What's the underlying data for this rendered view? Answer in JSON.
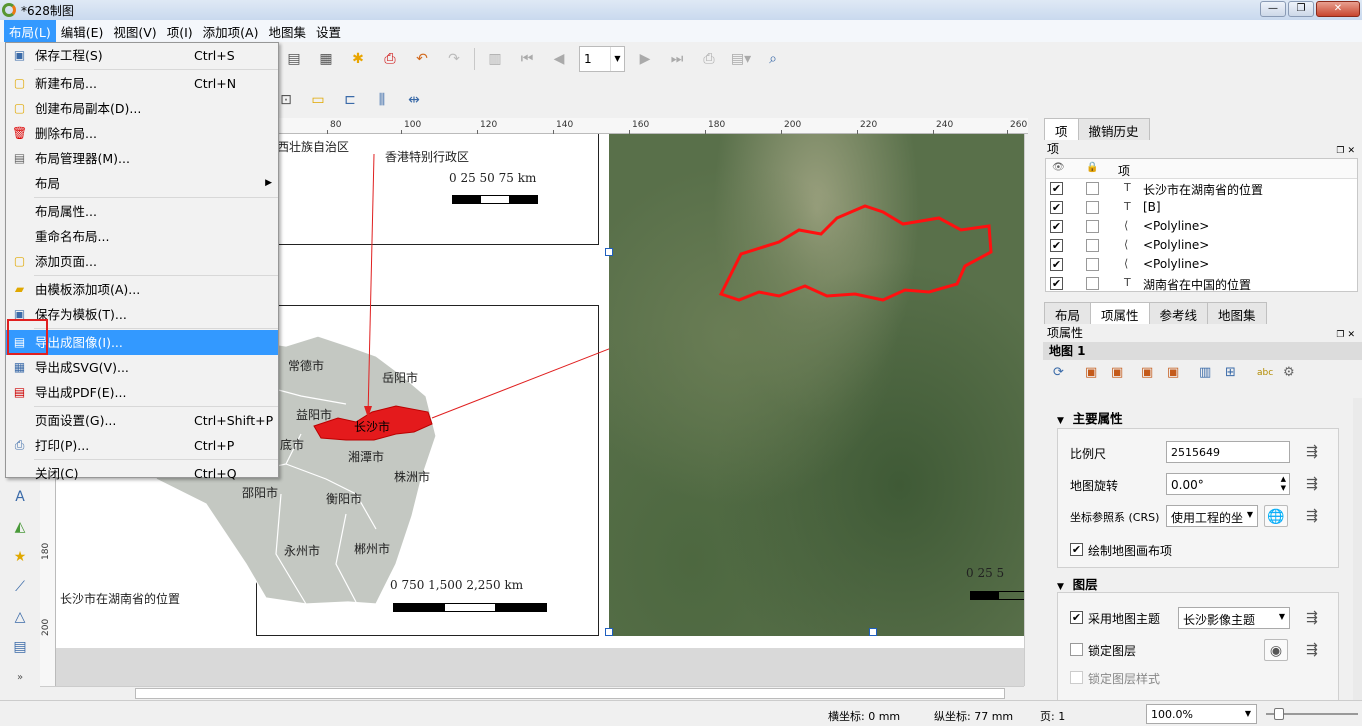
{
  "window": {
    "title": "*628制图",
    "minimize": "—",
    "maximize": "❐",
    "close": "✕"
  },
  "menubar": [
    "布局(L)",
    "编辑(E)",
    "视图(V)",
    "项(I)",
    "添加项(A)",
    "地图集",
    "设置"
  ],
  "toolbar": {
    "page_number": "1"
  },
  "dropdown": {
    "items": [
      {
        "label": "保存工程(S)",
        "shortcut": "Ctrl+S",
        "icon": "save-icon"
      },
      {
        "label": "新建布局...",
        "shortcut": "Ctrl+N",
        "icon": "new-layout-icon"
      },
      {
        "label": "创建布局副本(D)...",
        "shortcut": "",
        "icon": "duplicate-layout-icon"
      },
      {
        "label": "删除布局...",
        "shortcut": "",
        "icon": "delete-icon"
      },
      {
        "label": "布局管理器(M)...",
        "shortcut": "",
        "icon": "layout-manager-icon"
      },
      {
        "label": "布局",
        "shortcut": "",
        "icon": ""
      },
      {
        "label": "布局属性...",
        "shortcut": "",
        "icon": ""
      },
      {
        "label": "重命名布局...",
        "shortcut": "",
        "icon": ""
      },
      {
        "label": "添加页面...",
        "shortcut": "",
        "icon": "add-page-icon"
      },
      {
        "label": "由模板添加项(A)...",
        "shortcut": "",
        "icon": "folder-icon"
      },
      {
        "label": "保存为模板(T)...",
        "shortcut": "",
        "icon": "save-template-icon"
      },
      {
        "label": "导出成图像(I)...",
        "shortcut": "",
        "icon": "export-image-icon"
      },
      {
        "label": "导出成SVG(V)...",
        "shortcut": "",
        "icon": "export-svg-icon"
      },
      {
        "label": "导出成PDF(E)...",
        "shortcut": "",
        "icon": "export-pdf-icon"
      },
      {
        "label": "页面设置(G)...",
        "shortcut": "Ctrl+Shift+P",
        "icon": ""
      },
      {
        "label": "打印(P)...",
        "shortcut": "Ctrl+P",
        "icon": "print-icon"
      },
      {
        "label": "关闭(C)",
        "shortcut": "Ctrl+Q",
        "icon": ""
      }
    ]
  },
  "ruler_top": [
    "80",
    "100",
    "120",
    "140",
    "160",
    "180",
    "200",
    "220",
    "240",
    "260"
  ],
  "ruler_left": [
    "180",
    "200"
  ],
  "canvas": {
    "inset_labels": [
      "西壮族自治区",
      "香港特别行政区"
    ],
    "inset_scale": "0   25   50   75  km",
    "hunan_cities": [
      "常德市",
      "岳阳市",
      "益阳市",
      "长沙市",
      "湘潭市",
      "株洲市",
      "邵阳市",
      "衡阳市",
      "永州市",
      "郴州市",
      "底市"
    ],
    "hunan_scale": "0     750    1,500  2,250  km",
    "caption": "长沙市在湖南省的位置",
    "sat_scale": "0   25   5"
  },
  "dock": {
    "top_tabs": [
      "项",
      "撤销历史"
    ],
    "items_panel_title": "项",
    "items_header": "项",
    "items": [
      {
        "label": "长沙市在湖南省的位置",
        "type_icon": "T"
      },
      {
        "label": "[B]",
        "type_icon": "T"
      },
      {
        "label": "<Polyline>",
        "type_icon": "⟨"
      },
      {
        "label": "<Polyline>",
        "type_icon": "⟨"
      },
      {
        "label": "<Polyline>",
        "type_icon": "⟨"
      },
      {
        "label": "湖南省在中国的位置",
        "type_icon": "T"
      }
    ],
    "bottom_tabs": [
      "布局",
      "项属性",
      "参考线",
      "地图集"
    ],
    "props_title": "项属性",
    "props_subject": "地图 1",
    "main_section": "主要属性",
    "scale_label": "比例尺",
    "scale_value": "2515649",
    "rotation_label": "地图旋转",
    "rotation_value": "0.00°",
    "crs_label": "坐标参照系 (CRS)",
    "crs_value": "使用工程的坐",
    "draw_items_label": "绘制地图画布项",
    "layers_section": "图层",
    "follow_theme_label": "采用地图主题",
    "follow_theme_value": "长沙影像主题",
    "lock_layers_label": "锁定图层",
    "lock_styles_label": "锁定图层样式"
  },
  "statusbar": {
    "x_coord": "横坐标: 0 mm",
    "y_coord": "纵坐标: 77 mm",
    "page": "页: 1",
    "zoom": "100.0%"
  },
  "colors": {
    "highlight": "#3399ff",
    "red_annotation": "#e02020",
    "hunan_fill": "#c4c8c2",
    "changsha_fill": "#e41a1c"
  }
}
